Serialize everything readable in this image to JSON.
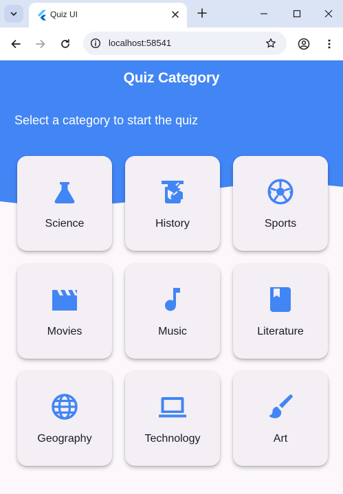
{
  "browser": {
    "tab_title": "Quiz UI",
    "url": "localhost:58541"
  },
  "colors": {
    "accent": "#4285f4",
    "card_bg": "#f3eff4",
    "page_bg": "#fbf7fb"
  },
  "app": {
    "title": "Quiz Category",
    "subtitle": "Select a category to start the quiz"
  },
  "categories": [
    {
      "label": "Science",
      "icon": "flask-icon"
    },
    {
      "label": "History",
      "icon": "history-edu-icon"
    },
    {
      "label": "Sports",
      "icon": "soccer-ball-icon"
    },
    {
      "label": "Movies",
      "icon": "movie-clapper-icon"
    },
    {
      "label": "Music",
      "icon": "music-note-icon"
    },
    {
      "label": "Literature",
      "icon": "book-icon"
    },
    {
      "label": "Geography",
      "icon": "globe-icon"
    },
    {
      "label": "Technology",
      "icon": "laptop-icon"
    },
    {
      "label": "Art",
      "icon": "brush-icon"
    }
  ]
}
